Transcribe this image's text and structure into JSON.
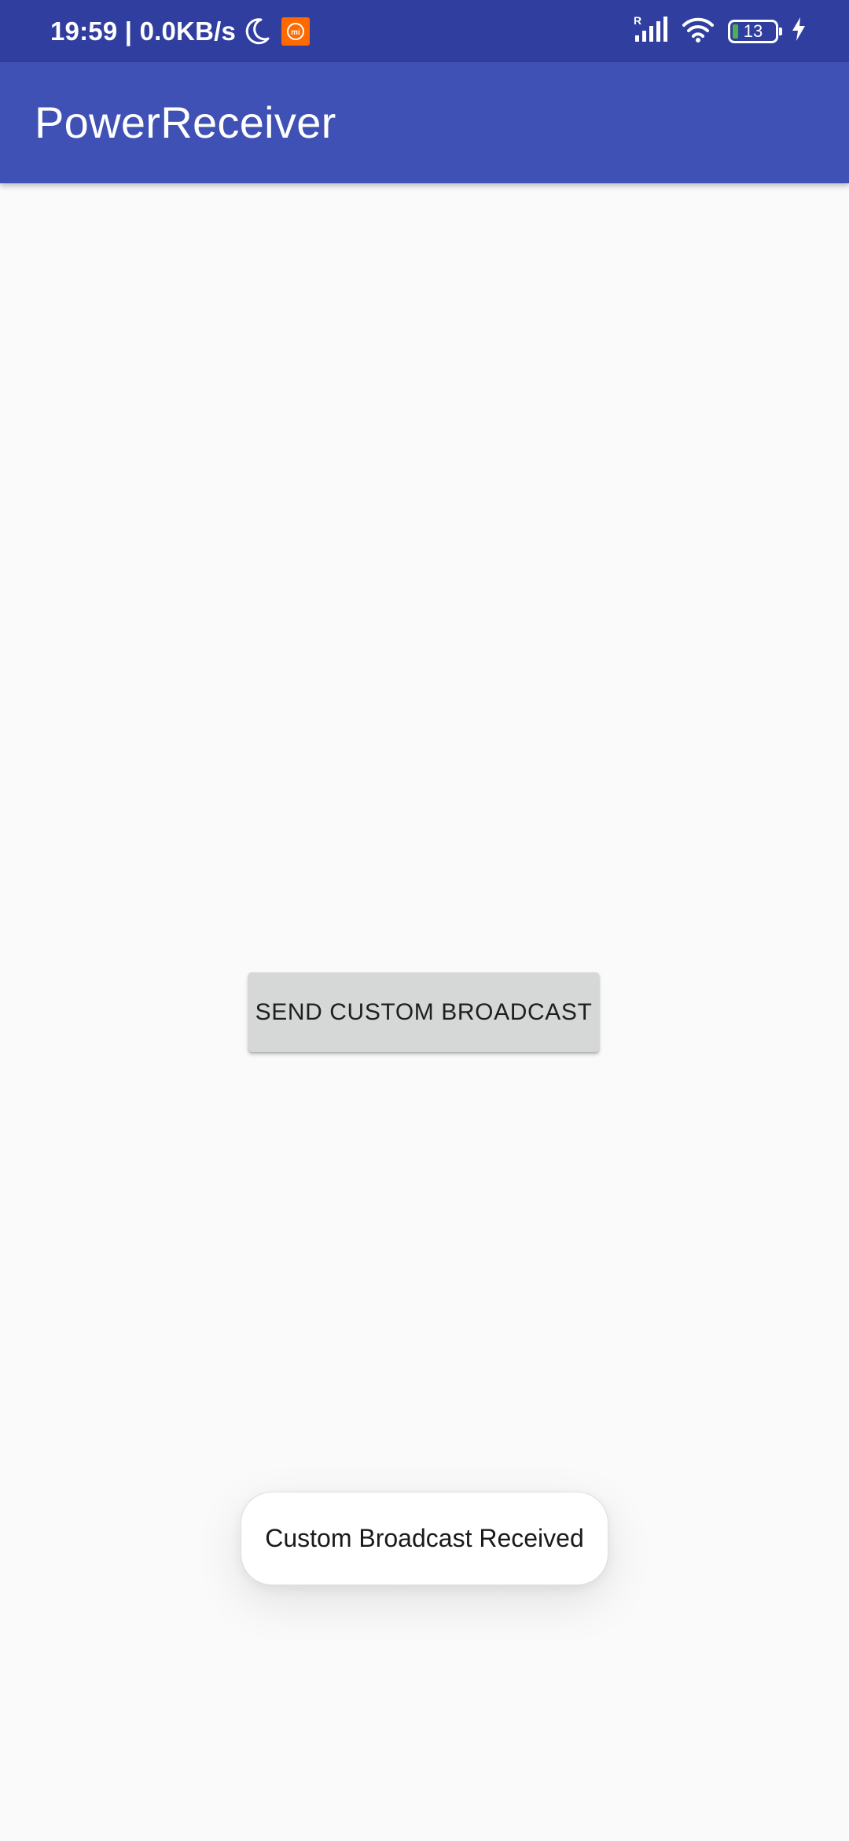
{
  "status_bar": {
    "time_and_speed": "19:59 | 0.0KB/s",
    "moon_icon": "do-not-disturb-moon-icon",
    "mi_icon": "mi-app-icon",
    "mi_text": "mi",
    "signal_roaming_letter": "R",
    "signal_icon": "cellular-signal-icon",
    "wifi_icon": "wifi-icon",
    "battery_level": "13",
    "battery_fraction": 0.13,
    "charging_icon": "charging-bolt-icon",
    "background_color": "#303f9f"
  },
  "app_bar": {
    "title": "PowerReceiver",
    "background_color": "#3f51b5"
  },
  "main": {
    "send_button_label": "SEND CUSTOM BROADCAST"
  },
  "toast": {
    "message": "Custom Broadcast Received"
  }
}
